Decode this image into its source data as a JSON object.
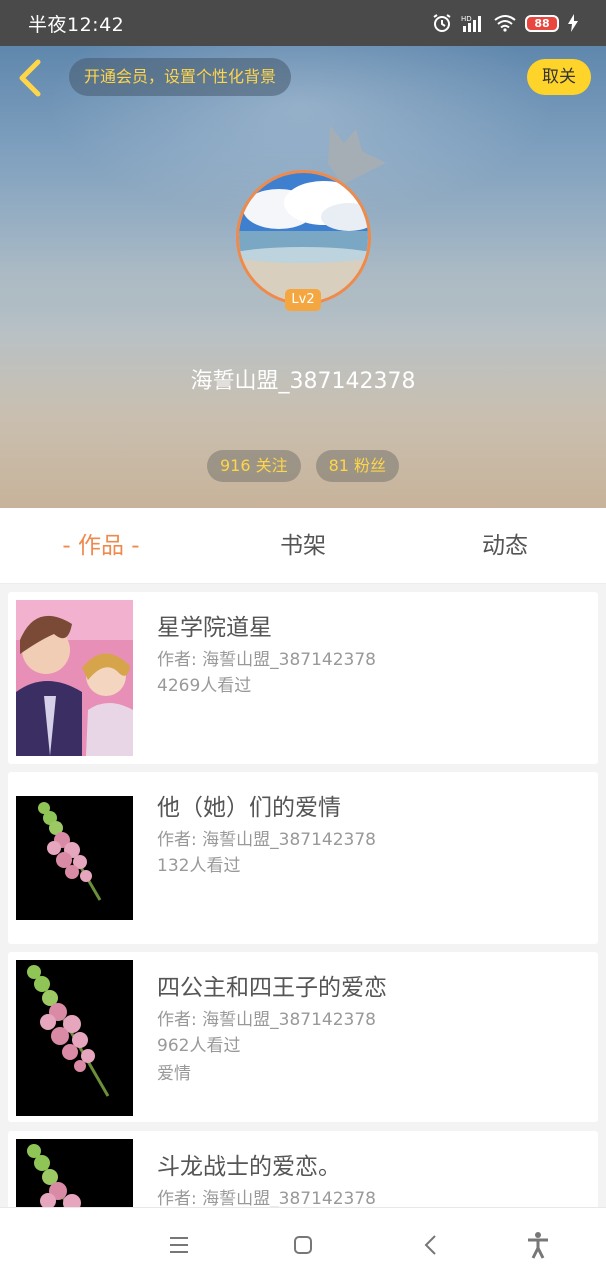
{
  "status_bar": {
    "time": "半夜12:42",
    "battery": "88",
    "icons": [
      "alarm-icon",
      "hd-signal-icon",
      "wifi-icon",
      "battery-icon",
      "charging-icon"
    ]
  },
  "header": {
    "vip_prompt": "开通会员，设置个性化背景",
    "cancel_follow_label": "取关",
    "level": "Lv2",
    "username": "海誓山盟_387142378",
    "following": "916 关注",
    "followers": "81 粉丝"
  },
  "tabs": [
    {
      "label": "- 作品 -",
      "active": true
    },
    {
      "label": "书架",
      "active": false
    },
    {
      "label": "动态",
      "active": false
    }
  ],
  "books": [
    {
      "title": "星学院道星",
      "author": "作者: 海誓山盟_387142378",
      "views": "4269人看过",
      "tag": ""
    },
    {
      "title": "他（她）们的爱情",
      "author": "作者: 海誓山盟_387142378",
      "views": "132人看过",
      "tag": ""
    },
    {
      "title": "四公主和四王子的爱恋",
      "author": "作者: 海誓山盟_387142378",
      "views": "962人看过",
      "tag": "爱情"
    },
    {
      "title": "斗龙战士的爱恋。",
      "author": "作者: 海誓山盟_387142378",
      "views": "",
      "tag": ""
    }
  ],
  "nav_bar": [
    "menu-icon",
    "home-icon",
    "back-icon",
    "accessibility-icon"
  ],
  "colors": {
    "accent": "#ee8a4e",
    "follow_button": "#ffd42a",
    "stat_text": "#ffd54a"
  }
}
